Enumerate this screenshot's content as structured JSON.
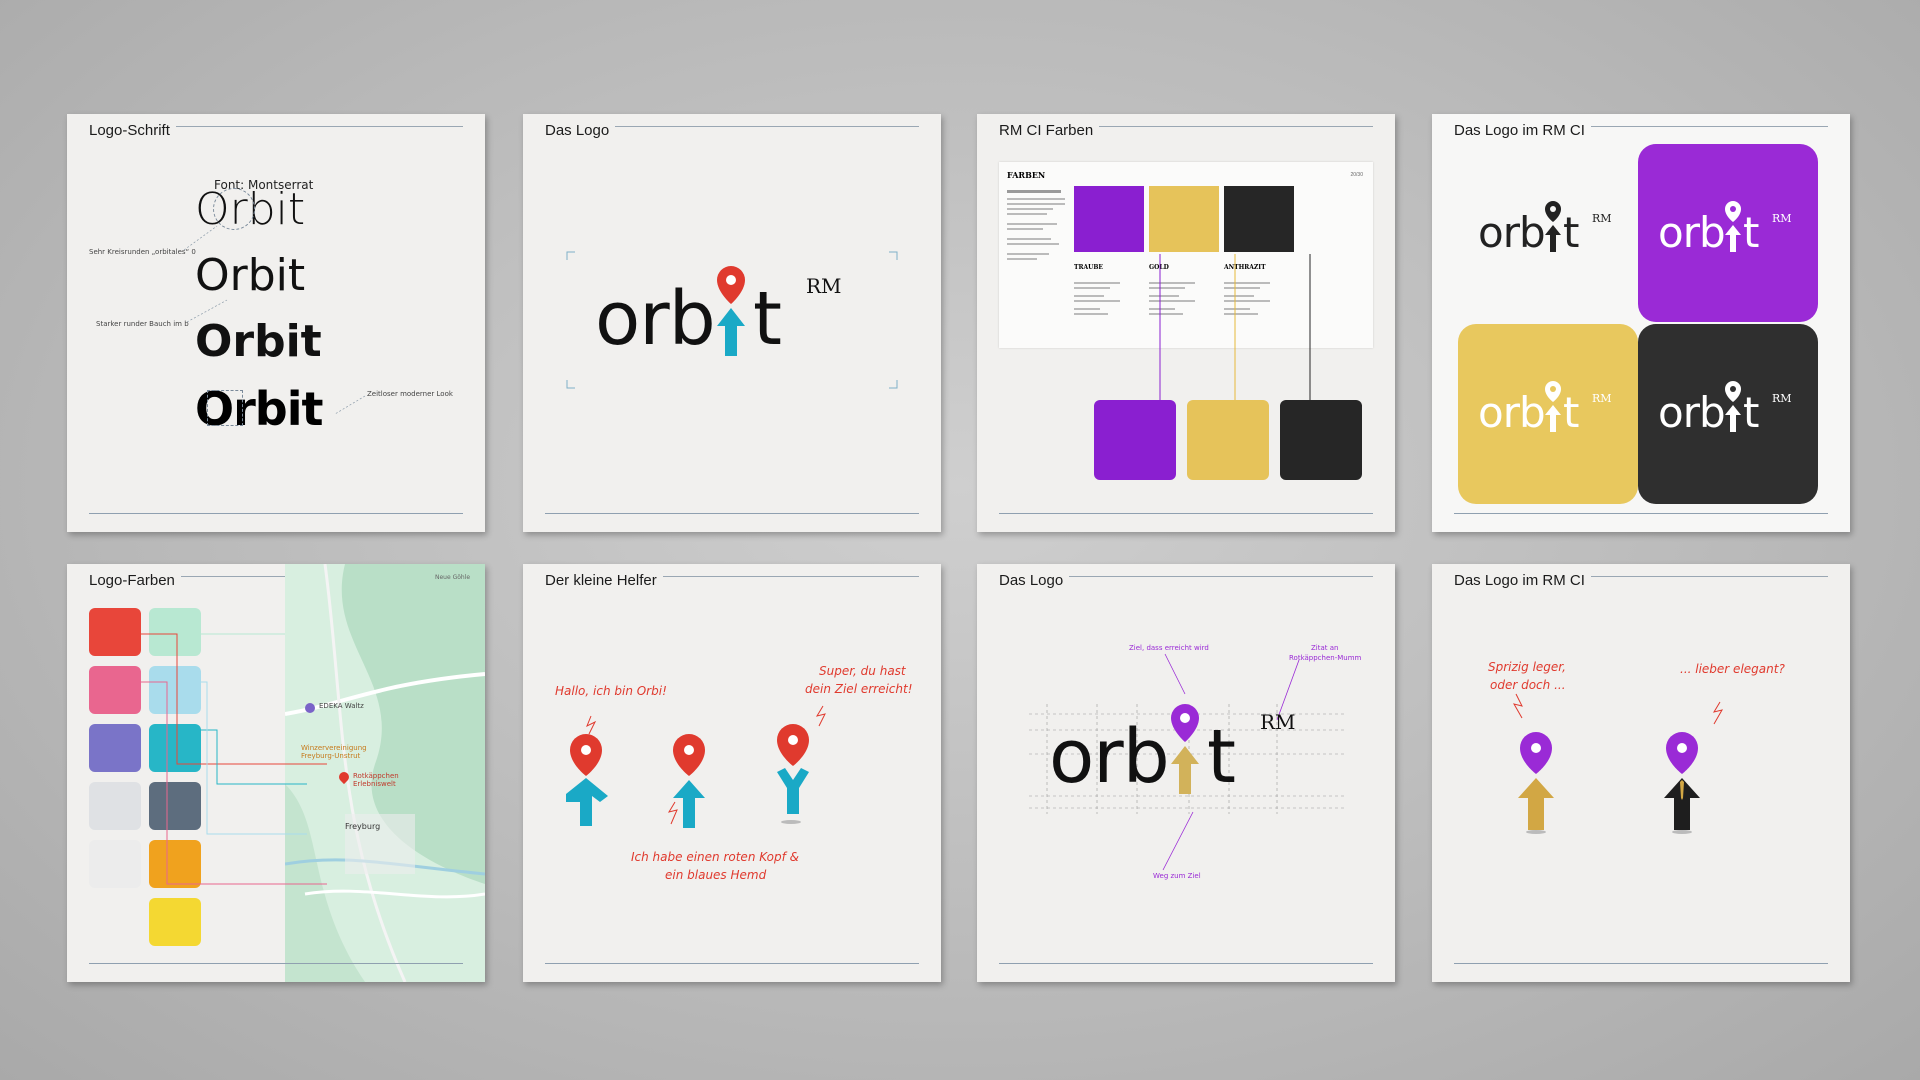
{
  "cards": {
    "c1": {
      "title": "Logo-Schrift",
      "font_label": "Font: Montserrat",
      "word": "Orbit",
      "note1": "Sehr Kreisrunden „orbitales“ 0",
      "note2": "Starker runder Bauch im b",
      "note3": "Zeitloser moderner Look"
    },
    "c2": {
      "title": "Das Logo",
      "word": "orb",
      "word_t": "t",
      "sup": "RM"
    },
    "c3": {
      "title": "RM CI Farben",
      "doc_heading": "FARBEN",
      "doc_page": "20/30",
      "colors": [
        {
          "name": "TRAUBE",
          "hex": "#8a1fd0"
        },
        {
          "name": "GOLD",
          "hex": "#e6c35a"
        },
        {
          "name": "ANTHRAZIT",
          "hex": "#262626"
        }
      ]
    },
    "c4": {
      "title": "Das Logo im RM CI",
      "word": "orb",
      "word_t": "t",
      "sup": "RM"
    },
    "c5": {
      "title": "Logo-Farben",
      "map_labels": {
        "town": "Freyburg",
        "poi": "Rotkäppchen Erlebniswelt",
        "shop": "EDEKA Waltz",
        "winery": "Winzervereinigung Freyburg-Unstrut",
        "school": "Neue Göhle"
      },
      "swatches": [
        "#e8463a",
        "#b8e8d2",
        "#e9668f",
        "#a9dcec",
        "#7a74c8",
        "#27b6c7",
        "#dfe1e4",
        "#5d6d7e",
        "#ececec",
        "#f0a21e",
        "#f4d832"
      ]
    },
    "c6": {
      "title": "Der kleine Helfer",
      "note1": "Hallo, ich bin Orbi!",
      "note2a": "Super, du hast",
      "note2b": "dein Ziel erreicht!",
      "note3a": "Ich habe einen roten Kopf &",
      "note3b": "ein blaues Hemd"
    },
    "c7": {
      "title": "Das Logo",
      "word": "orb",
      "word_t": "t",
      "sup": "RM",
      "note1": "Ziel, dass erreicht wird",
      "note2a": "Zitat an",
      "note2b": "Rotkäppchen-Mumm",
      "note3": "Weg zum Ziel"
    },
    "c8": {
      "title": "Das Logo im RM CI",
      "note1a": "Sprizig leger,",
      "note1b": "oder doch ...",
      "note2": "... lieber elegant?"
    }
  },
  "colors": {
    "red": "#e03a2e",
    "blue": "#1aa9c6",
    "purple": "#8e2cc9",
    "gold": "#e2c25c",
    "anthrazit": "#2f2f2f",
    "ink": "#141414"
  }
}
